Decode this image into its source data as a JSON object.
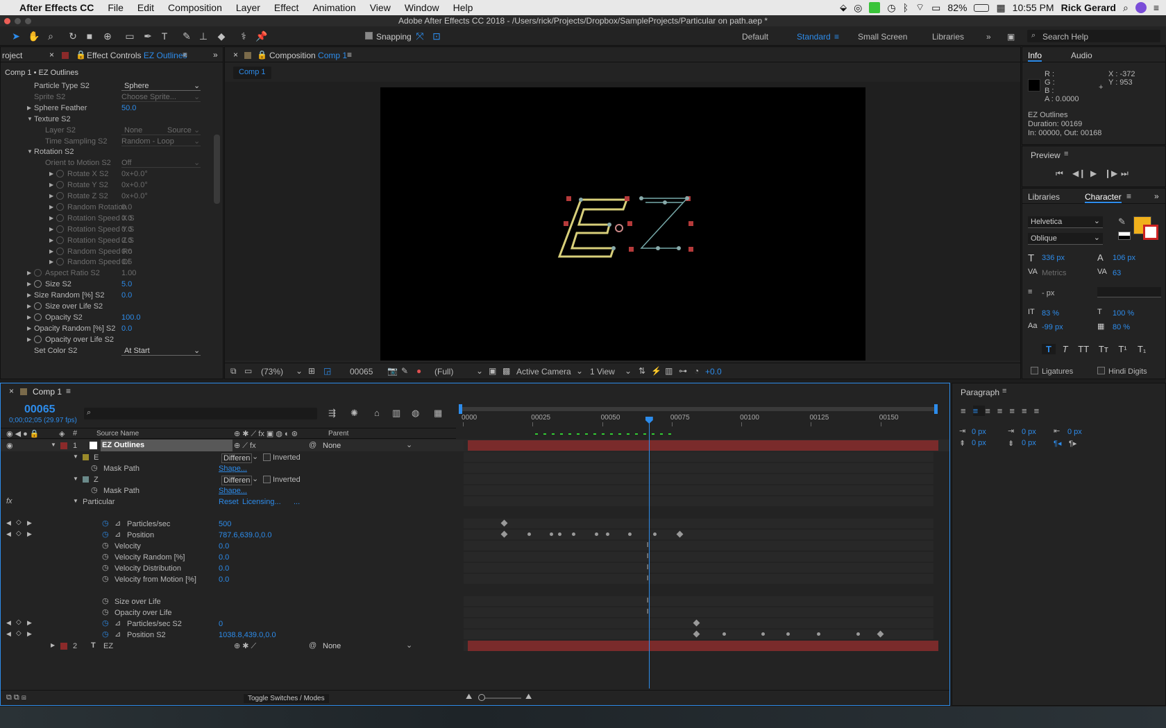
{
  "menubar": {
    "apple": "",
    "app": "After Effects CC",
    "items": [
      "File",
      "Edit",
      "Composition",
      "Layer",
      "Effect",
      "Animation",
      "View",
      "Window",
      "Help"
    ],
    "battery": "82%",
    "time": "10:55 PM",
    "user": "Rick Gerard"
  },
  "titlebar": {
    "title": "Adobe After Effects CC 2018 - /Users/rick/Projects/Dropbox/SampleProjects/Particular on path.aep *"
  },
  "toolbar": {
    "snapping": "Snapping",
    "workspaces": [
      "Default",
      "Standard",
      "Small Screen",
      "Libraries"
    ],
    "active_workspace": "Standard",
    "search_placeholder": "Search Help"
  },
  "project_tab": "roject",
  "effect_controls": {
    "tab_prefix": "Effect Controls",
    "tab_layer": "EZ Outlines",
    "breadcrumb": "Comp 1 • EZ Outlines",
    "rows": [
      {
        "label": "Particle Type S2",
        "value": "Sphere",
        "indent": 0,
        "tri": "",
        "dd": true,
        "dim": false
      },
      {
        "label": "Sprite S2",
        "value": "Choose Sprite...",
        "indent": 0,
        "tri": "",
        "dim": true
      },
      {
        "label": "Sphere Feather",
        "value": "50.0",
        "indent": 0,
        "tri": "▶",
        "blue": true
      },
      {
        "label": "Texture S2",
        "value": "",
        "indent": 0,
        "tri": "▼"
      },
      {
        "label": "Layer S2",
        "value": "None",
        "value2": "Source",
        "indent": 1,
        "tri": "",
        "dim": true
      },
      {
        "label": "Time Sampling S2",
        "value": "Random - Loop",
        "indent": 1,
        "tri": "",
        "dim": true
      },
      {
        "label": "Rotation S2",
        "value": "",
        "indent": 0,
        "tri": "▼"
      },
      {
        "label": "Orient to Motion S2",
        "value": "Off",
        "indent": 1,
        "tri": "",
        "dim": true
      },
      {
        "label": "Rotate X S2",
        "value": "0x+0.0°",
        "indent": 2,
        "tri": "▶",
        "sw": true,
        "dim": true
      },
      {
        "label": "Rotate Y S2",
        "value": "0x+0.0°",
        "indent": 2,
        "tri": "▶",
        "sw": true,
        "dim": true
      },
      {
        "label": "Rotate Z S2",
        "value": "0x+0.0°",
        "indent": 2,
        "tri": "▶",
        "sw": true,
        "dim": true
      },
      {
        "label": "Random Rotation",
        "value": "0.0",
        "indent": 2,
        "tri": "▶",
        "sw": true,
        "dim": true
      },
      {
        "label": "Rotation Speed X S",
        "value": "0.0",
        "indent": 2,
        "tri": "▶",
        "sw": true,
        "dim": true
      },
      {
        "label": "Rotation Speed Y S",
        "value": "0.0",
        "indent": 2,
        "tri": "▶",
        "sw": true,
        "dim": true
      },
      {
        "label": "Rotation Speed Z S",
        "value": "0.0",
        "indent": 2,
        "tri": "▶",
        "sw": true,
        "dim": true
      },
      {
        "label": "Random Speed Ro",
        "value": "0.0",
        "indent": 2,
        "tri": "▶",
        "sw": true,
        "dim": true
      },
      {
        "label": "Random Speed Di",
        "value": "0.5",
        "indent": 2,
        "tri": "▶",
        "sw": true,
        "dim": true
      },
      {
        "label": "Aspect Ratio S2",
        "value": "1.00",
        "indent": 0,
        "tri": "▶",
        "sw": true,
        "dim": true
      },
      {
        "label": "Size S2",
        "value": "5.0",
        "indent": 0,
        "tri": "▶",
        "sw": true,
        "blue": true
      },
      {
        "label": "Size Random [%] S2",
        "value": "0.0",
        "indent": 0,
        "tri": "▶",
        "blue": true
      },
      {
        "label": "Size over Life S2",
        "value": "",
        "indent": 0,
        "tri": "▶",
        "sw": true
      },
      {
        "label": "Opacity S2",
        "value": "100.0",
        "indent": 0,
        "tri": "▶",
        "sw": true,
        "blue": true
      },
      {
        "label": "Opacity Random [%] S2",
        "value": "0.0",
        "indent": 0,
        "tri": "▶",
        "blue": true
      },
      {
        "label": "Opacity over Life S2",
        "value": "",
        "indent": 0,
        "tri": "▶",
        "sw": true
      },
      {
        "label": "Set Color S2",
        "value": "At Start",
        "indent": 0,
        "tri": "",
        "dd": true
      }
    ]
  },
  "composition": {
    "tab_prefix": "Composition",
    "tab_comp": "Comp 1",
    "comp_button": "Comp 1",
    "footer": {
      "zoom": "(73%)",
      "timecode": "00065",
      "resolution": "(Full)",
      "camera": "Active Camera",
      "views": "1 View",
      "exposure": "+0.0"
    }
  },
  "info": {
    "tab": "Info",
    "tab2": "Audio",
    "r": "R :",
    "g": "G :",
    "b": "B :",
    "a": "A : 0.0000",
    "x": "X : -372",
    "y": "Y : 953",
    "layer": "EZ Outlines",
    "duration": "Duration: 00169",
    "inout": "In: 00000, Out: 00168"
  },
  "preview": {
    "title": "Preview"
  },
  "character": {
    "tab_libraries": "Libraries",
    "tab": "Character",
    "font": "Helvetica",
    "style": "Oblique",
    "size": "336 px",
    "leading": "106 px",
    "kerning": "Metrics",
    "tracking": "63",
    "stroke": "- px",
    "vscale": "83 %",
    "hscale": "100 %",
    "baseline": "-99 px",
    "tsume": "80 %",
    "ligatures": "Ligatures",
    "hindi": "Hindi Digits",
    "fill_color": "#f0b01c",
    "styles": [
      "T",
      "T",
      "TT",
      "Tт",
      "T¹",
      "T₁"
    ]
  },
  "paragraph": {
    "title": "Paragraph",
    "indent_left": "0 px",
    "indent_first": "0 px",
    "indent_right": "0 px",
    "space_before": "0 px",
    "space_after": "0 px"
  },
  "timeline": {
    "tab": "Comp 1",
    "timecode": "00065",
    "fps": "0;00;02;05 (29.97 fps)",
    "col_source": "Source Name",
    "col_parent": "Parent",
    "ruler": [
      "0000",
      "00025",
      "00050",
      "00075",
      "00100",
      "00125",
      "00150"
    ],
    "toggle": "Toggle Switches / Modes",
    "current_frame": 65,
    "total_frames": 169,
    "layers": [
      {
        "num": "1",
        "name": "EZ Outlines",
        "parent": "None",
        "type": "shape"
      },
      {
        "num": "2",
        "name": "EZ",
        "parent": "None",
        "type": "text"
      }
    ],
    "props": {
      "mask_e": "E",
      "mask_z": "Z",
      "mode": "Differen",
      "inverted": "Inverted",
      "mask_path": "Mask Path",
      "shape": "Shape...",
      "particular": "Particular",
      "reset": "Reset",
      "licensing": "Licensing...",
      "dots": "...",
      "rows": [
        {
          "label": "Particles/sec",
          "value": "500",
          "keys": [
            13
          ]
        },
        {
          "label": "Position",
          "value": "787.6,639.0,0.0",
          "keys": [
            13,
            22,
            30,
            33,
            38,
            46,
            50,
            58,
            67,
            76
          ]
        },
        {
          "label": "Velocity",
          "value": "0.0"
        },
        {
          "label": "Velocity Random [%]",
          "value": "0.0"
        },
        {
          "label": "Velocity Distribution",
          "value": "0.0"
        },
        {
          "label": "Velocity from Motion [%]",
          "value": "0.0"
        },
        {
          "label": "Size over Life",
          "value": ""
        },
        {
          "label": "Opacity over Life",
          "value": ""
        },
        {
          "label": "Particles/sec S2",
          "value": "0",
          "keys": [
            82
          ]
        },
        {
          "label": "Position S2",
          "value": "1038.8,439.0,0.0",
          "keys": [
            82,
            92,
            106,
            115,
            126,
            140,
            148
          ]
        }
      ]
    }
  }
}
